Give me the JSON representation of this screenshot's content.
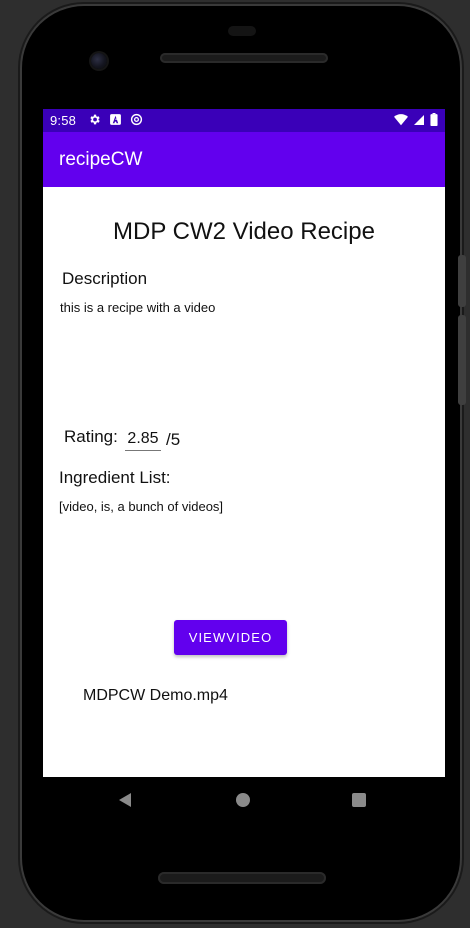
{
  "status_bar": {
    "time": "9:58",
    "left_icons": [
      "settings-icon",
      "app-a-icon",
      "sync-circle-icon"
    ],
    "right_icons": [
      "wifi-icon",
      "signal-icon",
      "battery-icon"
    ],
    "color": "#3a00b8"
  },
  "app_bar": {
    "title": "recipeCW",
    "color": "#6200ee"
  },
  "recipe": {
    "title": "MDP CW2 Video Recipe",
    "description_label": "Description",
    "description_text": "this is a recipe with a video",
    "rating_label": "Rating:",
    "rating_value": "2.85",
    "rating_suffix": "/5",
    "ingredients_label": "Ingredient List:",
    "ingredients_text": "[video, is, a bunch of videos]",
    "view_video_label": "VIEWVIDEO",
    "video_file": "MDPCW Demo.mp4"
  },
  "nav_bar": {
    "buttons": [
      "back-icon",
      "home-icon",
      "recent-apps-icon"
    ]
  }
}
